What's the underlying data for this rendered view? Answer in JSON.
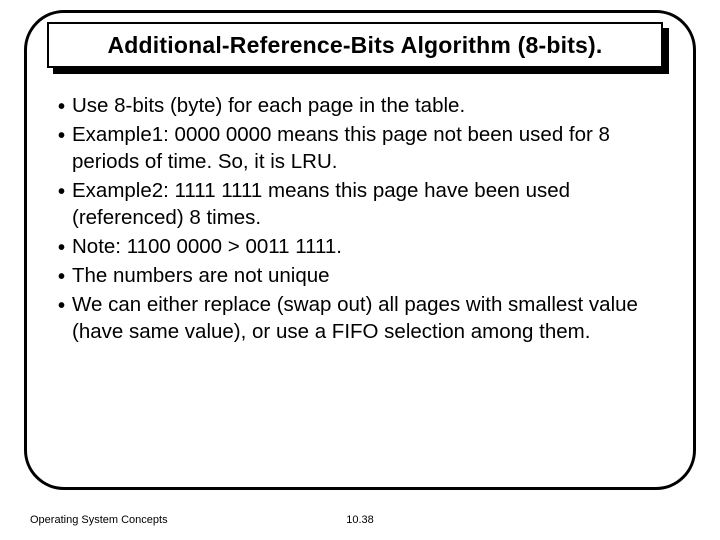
{
  "title": "Additional-Reference-Bits Algorithm (8-bits).",
  "bullets": [
    "Use 8-bits (byte) for each page in the table.",
    "Example1: 0000 0000 means this page not been used for 8 periods of time. So, it is LRU.",
    "Example2: 1111 1111 means this page have been used (referenced) 8 times.",
    "Note: 1100 0000 > 0011 1111.",
    "The numbers are not unique",
    "We can either replace (swap out) all pages with smallest value (have same value), or use a FIFO selection among them."
  ],
  "footer": {
    "left": "Operating System Concepts",
    "center": "10.38"
  }
}
